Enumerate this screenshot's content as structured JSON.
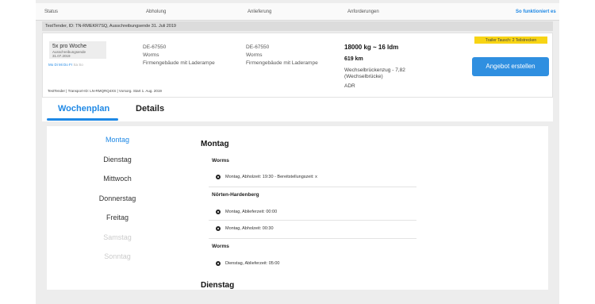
{
  "columns": {
    "status": "Status",
    "pickup": "Abholung",
    "delivery": "Anlieferung",
    "requirements": "Anforderungen",
    "help_link": "So funktioniert es"
  },
  "tender_bar": "TestTender, ID: TN-RMEKR7SQ, Ausschreibungsende 31. Juli 2019",
  "card": {
    "frequency": "5x pro Woche",
    "deadline": "Ausschreibungsende 31.07.2019",
    "days_active": "Mo Di Mi Do Fr",
    "days_inactive": "Sa So",
    "pickup": {
      "zip": "DE-67550",
      "city": "Worms",
      "location": "Firmengebäude mit Laderampe"
    },
    "delivery": {
      "zip": "DE-67550",
      "city": "Worms",
      "location": "Firmengebäude mit Laderampe"
    },
    "weight": "18000 kg ~ 16 ldm",
    "distance": "619 km",
    "vehicle": "Wechselbrückenzug - 7,82 (Wechselbrücke)",
    "adr": "ADR",
    "badge": "Trailer Tausch: 2 Teilstrecken",
    "cta": "Angebot erstellen",
    "transport_info": "TestTender | Transport-ID: LN-RMQRQ4XS | Vorsorg. Start 1. Aug. 2019"
  },
  "tabs": [
    "Wochenplan",
    "Details"
  ],
  "days": [
    "Montag",
    "Dienstag",
    "Mittwoch",
    "Donnerstag",
    "Freitag",
    "Samstag",
    "Sonntag"
  ],
  "schedule": {
    "day1": "Montag",
    "loc1": "Worms",
    "e1": "Montag, Abholzeit: 19:30 - Bereitstellungszeit: x",
    "loc2": "Nörten-Hardenberg",
    "e2": "Montag, Ablieferzeit: 00:00",
    "e3": "Montag, Abholzeit: 00:30",
    "loc3": "Worms",
    "e4": "Dienstag, Ablieferzeit: 05:00",
    "day2": "Dienstag"
  },
  "colors": {
    "accent": "#1e88e5",
    "button": "#2f8fe0",
    "badge": "#f7d414"
  }
}
